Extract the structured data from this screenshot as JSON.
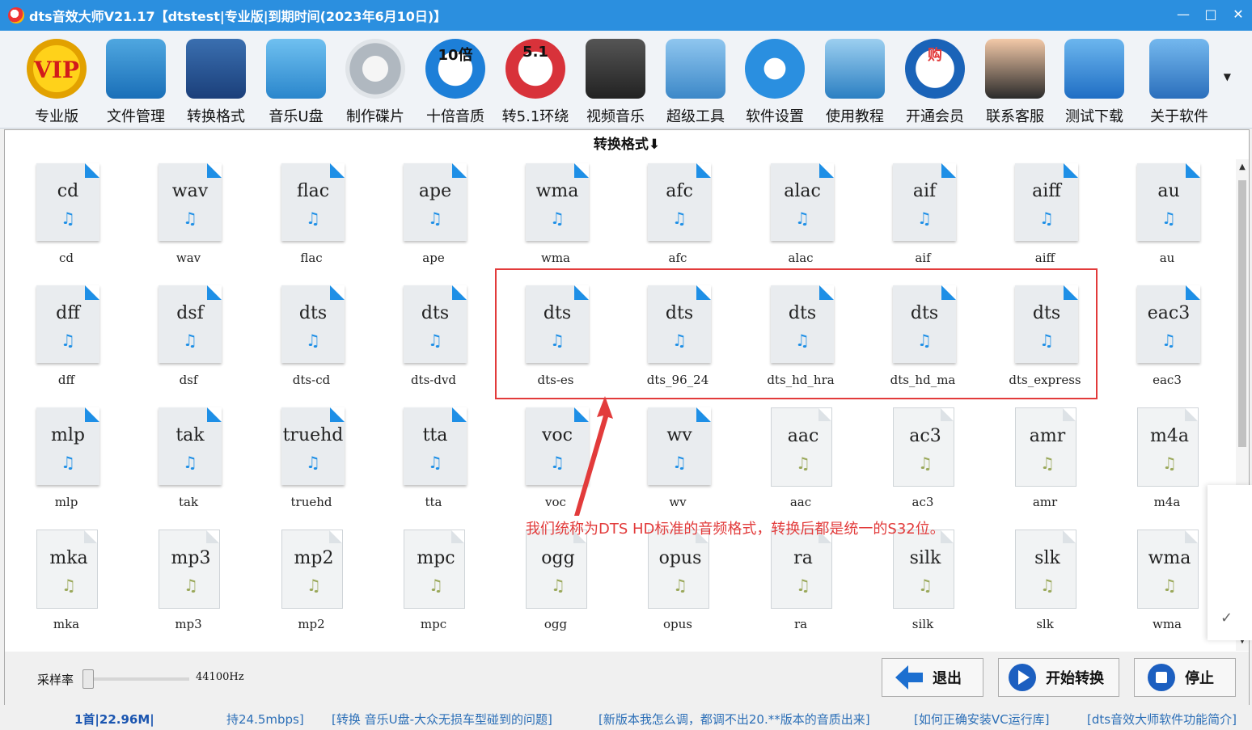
{
  "window": {
    "title": "dts音效大师V21.17【dtstest|专业版|到期时间(2023年6月10日)】",
    "controls": {
      "minimize": "—",
      "maximize": "□",
      "close": "✕"
    }
  },
  "toolbar": {
    "items": [
      {
        "label": "专业版",
        "icon": "vip-badge-icon"
      },
      {
        "label": "文件管理",
        "icon": "folder-file-icon"
      },
      {
        "label": "转换格式",
        "icon": "music-convert-icon"
      },
      {
        "label": "音乐U盘",
        "icon": "usb-drive-icon"
      },
      {
        "label": "制作碟片",
        "icon": "disc-music-icon"
      },
      {
        "label": "十倍音质",
        "icon": "ten-times-quality-icon",
        "badge": "10倍"
      },
      {
        "label": "转5.1环绕",
        "icon": "surround-51-icon",
        "badge": "5.1"
      },
      {
        "label": "视频音乐",
        "icon": "video-clapper-icon"
      },
      {
        "label": "超级工具",
        "icon": "tools-wrench-icon"
      },
      {
        "label": "软件设置",
        "icon": "settings-gear-icon"
      },
      {
        "label": "使用教程",
        "icon": "help-book-icon"
      },
      {
        "label": "开通会员",
        "icon": "membership-cart-icon",
        "badge": "购"
      },
      {
        "label": "联系客服",
        "icon": "customer-service-icon"
      },
      {
        "label": "测试下载",
        "icon": "download-arrow-icon"
      },
      {
        "label": "关于软件",
        "icon": "about-computer-icon"
      }
    ]
  },
  "panel": {
    "header": "转换格式⬇",
    "formats": [
      {
        "name": "cd",
        "caption": "cd",
        "style": "lossless"
      },
      {
        "name": "wav",
        "caption": "wav",
        "style": "lossless"
      },
      {
        "name": "flac",
        "caption": "flac",
        "style": "lossless"
      },
      {
        "name": "ape",
        "caption": "ape",
        "style": "lossless"
      },
      {
        "name": "wma",
        "caption": "wma",
        "style": "lossless"
      },
      {
        "name": "afc",
        "caption": "afc",
        "style": "lossless"
      },
      {
        "name": "alac",
        "caption": "alac",
        "style": "lossless"
      },
      {
        "name": "aif",
        "caption": "aif",
        "style": "lossless"
      },
      {
        "name": "aiff",
        "caption": "aiff",
        "style": "lossless"
      },
      {
        "name": "au",
        "caption": "au",
        "style": "lossless"
      },
      {
        "name": "dff",
        "caption": "dff",
        "style": "lossless"
      },
      {
        "name": "dsf",
        "caption": "dsf",
        "style": "lossless"
      },
      {
        "name": "dts",
        "caption": "dts-cd",
        "style": "lossless"
      },
      {
        "name": "dts",
        "caption": "dts-dvd",
        "style": "lossless"
      },
      {
        "name": "dts",
        "caption": "dts-es",
        "style": "lossless"
      },
      {
        "name": "dts",
        "caption": "dts_96_24",
        "style": "lossless"
      },
      {
        "name": "dts",
        "caption": "dts_hd_hra",
        "style": "lossless"
      },
      {
        "name": "dts",
        "caption": "dts_hd_ma",
        "style": "lossless"
      },
      {
        "name": "dts",
        "caption": "dts_express",
        "style": "lossless"
      },
      {
        "name": "eac3",
        "caption": "eac3",
        "style": "lossless"
      },
      {
        "name": "mlp",
        "caption": "mlp",
        "style": "lossless"
      },
      {
        "name": "tak",
        "caption": "tak",
        "style": "lossless"
      },
      {
        "name": "truehd",
        "caption": "truehd",
        "style": "lossless"
      },
      {
        "name": "tta",
        "caption": "tta",
        "style": "lossless"
      },
      {
        "name": "voc",
        "caption": "voc",
        "style": "lossless"
      },
      {
        "name": "wv",
        "caption": "wv",
        "style": "lossless"
      },
      {
        "name": "aac",
        "caption": "aac",
        "style": "lossy"
      },
      {
        "name": "ac3",
        "caption": "ac3",
        "style": "lossy"
      },
      {
        "name": "amr",
        "caption": "amr",
        "style": "lossy"
      },
      {
        "name": "m4a",
        "caption": "m4a",
        "style": "lossy"
      },
      {
        "name": "mka",
        "caption": "mka",
        "style": "lossy"
      },
      {
        "name": "mp3",
        "caption": "mp3",
        "style": "lossy"
      },
      {
        "name": "mp2",
        "caption": "mp2",
        "style": "lossy"
      },
      {
        "name": "mpc",
        "caption": "mpc",
        "style": "lossy"
      },
      {
        "name": "ogg",
        "caption": "ogg",
        "style": "lossy"
      },
      {
        "name": "opus",
        "caption": "opus",
        "style": "lossy"
      },
      {
        "name": "ra",
        "caption": "ra",
        "style": "lossy"
      },
      {
        "name": "silk",
        "caption": "silk",
        "style": "lossy"
      },
      {
        "name": "slk",
        "caption": "slk",
        "style": "lossy"
      },
      {
        "name": "wma",
        "caption": "wma",
        "style": "lossy"
      }
    ],
    "music_note": "♫",
    "annotation": "我们统称为DTS HD标准的音频格式，转换后都是统一的S32位。",
    "side_tip_check": "✓",
    "scroll_up": "▲",
    "scroll_down": "▼"
  },
  "controls": {
    "sample_rate_label": "采样率",
    "sample_rate_value": "44100Hz",
    "sample_rate_slider_fraction": 0.0,
    "exit_label": "退出",
    "start_label": "开始转换",
    "stop_label": "停止"
  },
  "statusbar": {
    "items": [
      "1首|22.96M|",
      "持24.5mbps]",
      "[转换 音乐U盘-大众无损车型碰到的问题]",
      "[新版本我怎么调，都调不出20.**版本的音质出来]",
      "[如何正确安装VC运行库]",
      "[dts音效大师软件功能简介]"
    ]
  },
  "colors": {
    "titlebar": "#2b8fdf",
    "accent_blue": "#1e8fe6",
    "highlight_red": "#e23b3b",
    "status_link": "#2c6fb7"
  }
}
